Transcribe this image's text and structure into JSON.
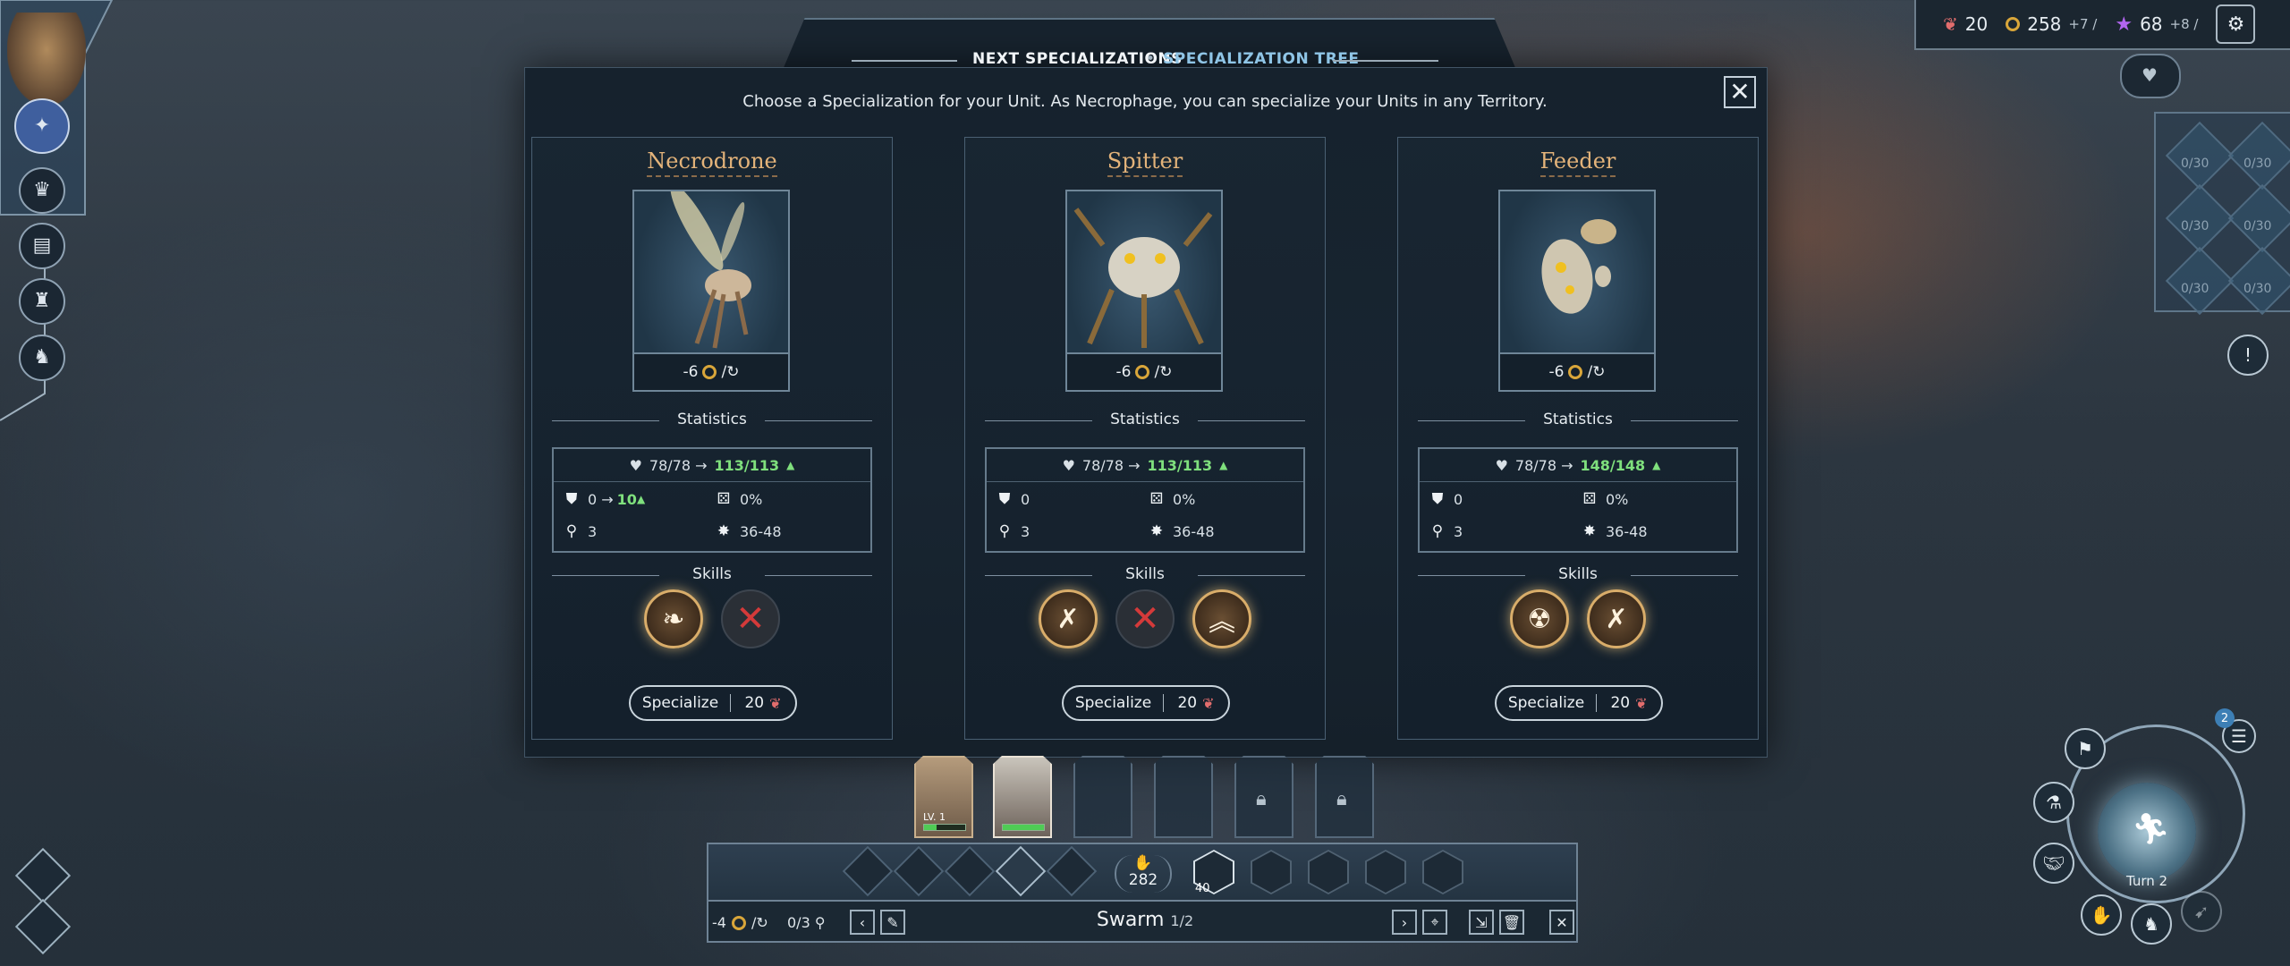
{
  "resources": {
    "food": "20",
    "gold": "258",
    "gold_rate": "+7 /",
    "influence": "68",
    "influence_rate": "+8 /"
  },
  "right_panel": {
    "slots": [
      "0/30",
      "0/30",
      "0/30",
      "0/30",
      "0/30",
      "0/30"
    ]
  },
  "dialog": {
    "tab_next": "NEXT SPECIALIZATIONS",
    "tab_separator": "•",
    "tab_tree": "SPECIALIZATION TREE",
    "subtitle": "Choose a Specialization for your Unit. As Necrophage, you can specialize your Units in any Territory.",
    "close_label": "✕",
    "statistics_label": "Statistics",
    "skills_label": "Skills",
    "specialize_label": "Specialize"
  },
  "cards": [
    {
      "name": "Necrodrone",
      "cost": "-6",
      "hp_old": "78/78 →",
      "hp_new": "113/113",
      "armor": "0 →",
      "armor_new": "10",
      "accuracy": "0%",
      "movement": "3",
      "damage": "36-48",
      "price": "20"
    },
    {
      "name": "Spitter",
      "cost": "-6",
      "hp_old": "78/78 →",
      "hp_new": "113/113",
      "armor": "0",
      "armor_new": "",
      "accuracy": "0%",
      "movement": "3",
      "damage": "36-48",
      "price": "20"
    },
    {
      "name": "Feeder",
      "cost": "-6",
      "hp_old": "78/78 →",
      "hp_new": "148/148",
      "armor": "0",
      "armor_new": "",
      "accuracy": "0%",
      "movement": "3",
      "damage": "36-48",
      "price": "20"
    }
  ],
  "unit_bar": {
    "population": "282",
    "ability_cost": "40",
    "unit_upkeep": "-4",
    "moves": "0/3",
    "unit_name": "Swarm",
    "unit_index": "1/2",
    "slot1_level": "LV. 1"
  },
  "turn": {
    "label": "Turn 2",
    "badge": "2"
  },
  "colors": {
    "accent_gold": "#e3b37a",
    "hp_gain": "#7fe07d",
    "tab_active": "#8fc5e6"
  }
}
